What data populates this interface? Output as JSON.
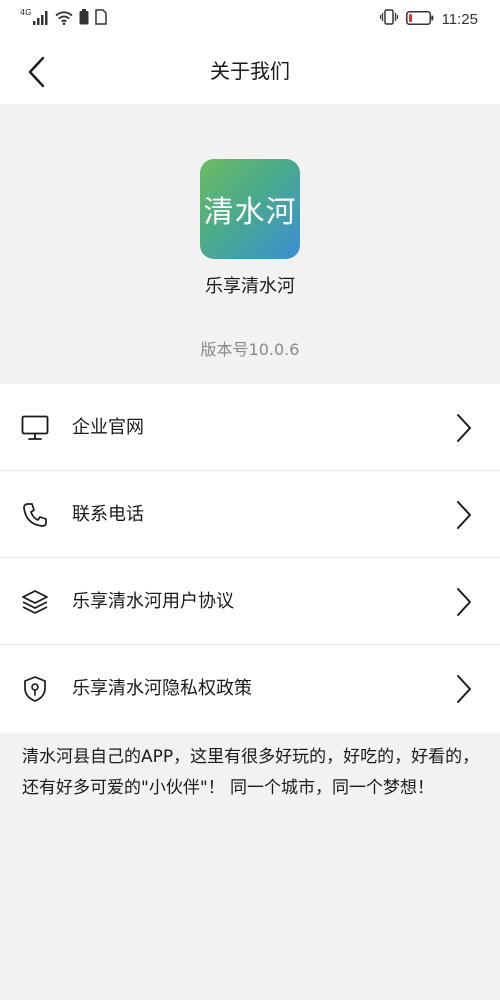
{
  "status_bar": {
    "network_label": "4G",
    "time": "11:25"
  },
  "nav": {
    "title": "关于我们"
  },
  "app": {
    "icon_text": "清水河",
    "name": "乐享清水河",
    "version": "版本号10.0.6"
  },
  "menu": {
    "items": [
      {
        "label": "企业官网",
        "icon": "monitor-icon"
      },
      {
        "label": "联系电话",
        "icon": "phone-icon"
      },
      {
        "label": "乐享清水河用户协议",
        "icon": "layers-icon"
      },
      {
        "label": "乐享清水河隐私权政策",
        "icon": "shield-lock-icon"
      }
    ]
  },
  "description": "清水河县自己的APP，这里有很多好玩的，好吃的，好看的，还有好多可爱的\"小伙伴\"！ 同一个城市，同一个梦想！",
  "colors": {
    "page_background": "#f2f2f2",
    "surface": "#ffffff",
    "icon_gradient_start": "#6dbb63",
    "icon_gradient_end": "#3b8fd6",
    "battery_low": "#e5312e",
    "secondary_text": "#8a8a8a"
  }
}
